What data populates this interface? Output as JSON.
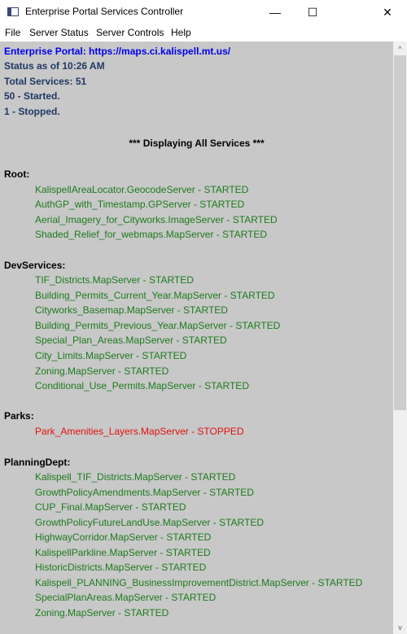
{
  "window": {
    "title": "Enterprise Portal Services Controller",
    "minimize_glyph": "—",
    "maximize_glyph": "☐",
    "close_glyph": "✕"
  },
  "menu": [
    "File",
    "Server Status",
    "Server Controls",
    "Help"
  ],
  "summary": {
    "portal_line": "Enterprise Portal: https://maps.ci.kalispell.mt.us/",
    "status_time": "Status as of 10:26 AM",
    "total_services": "Total Services: 51",
    "started": "50 - Started.",
    "stopped": "1 - Stopped."
  },
  "display_heading": "*** Displaying All Services ***",
  "folders": [
    {
      "name": "Root:",
      "services": [
        {
          "text": "KalispellAreaLocator.GeocodeServer - STARTED",
          "status": "started"
        },
        {
          "text": "AuthGP_with_Timestamp.GPServer - STARTED",
          "status": "started"
        },
        {
          "text": "Aerial_Imagery_for_Cityworks.ImageServer - STARTED",
          "status": "started"
        },
        {
          "text": "Shaded_Relief_for_webmaps.MapServer - STARTED",
          "status": "started"
        }
      ]
    },
    {
      "name": "DevServices:",
      "services": [
        {
          "text": "TIF_Districts.MapServer - STARTED",
          "status": "started"
        },
        {
          "text": "Building_Permits_Current_Year.MapServer - STARTED",
          "status": "started"
        },
        {
          "text": "Cityworks_Basemap.MapServer - STARTED",
          "status": "started"
        },
        {
          "text": "Building_Permits_Previous_Year.MapServer - STARTED",
          "status": "started"
        },
        {
          "text": "Special_Plan_Areas.MapServer - STARTED",
          "status": "started"
        },
        {
          "text": "City_Limits.MapServer - STARTED",
          "status": "started"
        },
        {
          "text": "Zoning.MapServer - STARTED",
          "status": "started"
        },
        {
          "text": "Conditional_Use_Permits.MapServer - STARTED",
          "status": "started"
        }
      ]
    },
    {
      "name": "Parks:",
      "services": [
        {
          "text": "Park_Amenities_Layers.MapServer - STOPPED",
          "status": "stopped"
        }
      ]
    },
    {
      "name": "PlanningDept:",
      "services": [
        {
          "text": "Kalispell_TIF_Districts.MapServer - STARTED",
          "status": "started"
        },
        {
          "text": "GrowthPolicyAmendments.MapServer - STARTED",
          "status": "started"
        },
        {
          "text": "CUP_Final.MapServer - STARTED",
          "status": "started"
        },
        {
          "text": "GrowthPolicyFutureLandUse.MapServer - STARTED",
          "status": "started"
        },
        {
          "text": "HighwayCorridor.MapServer - STARTED",
          "status": "started"
        },
        {
          "text": "KalispellParkline.MapServer - STARTED",
          "status": "started"
        },
        {
          "text": "HistoricDistricts.MapServer - STARTED",
          "status": "started"
        },
        {
          "text": "Kalispell_PLANNING_BusinessImprovementDistrict.MapServer - STARTED",
          "status": "started"
        },
        {
          "text": "SpecialPlanAreas.MapServer - STARTED",
          "status": "started"
        },
        {
          "text": "Zoning.MapServer - STARTED",
          "status": "started"
        }
      ]
    }
  ],
  "scrollbar": {
    "up_glyph": "^",
    "down_glyph": "v"
  },
  "colors": {
    "content_bg": "#c8c8c8",
    "header_text": "#1f3864",
    "portal_link": "#0000ee",
    "started": "#1d7a1d",
    "stopped": "#e01010"
  }
}
